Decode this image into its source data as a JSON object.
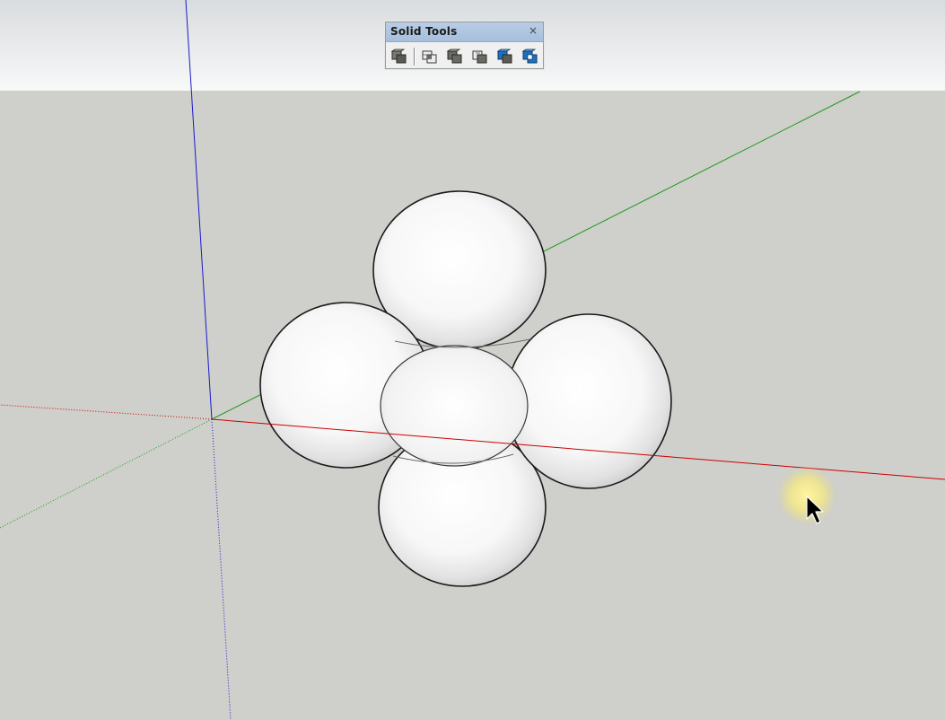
{
  "toolbar": {
    "title": "Solid Tools",
    "close_glyph": "×",
    "tools": [
      {
        "icon": "outer-shell-icon",
        "accent": "#5a5a52"
      },
      {
        "icon": "intersect-icon",
        "accent": "#5a5a52"
      },
      {
        "icon": "union-icon",
        "accent": "#5a5a52"
      },
      {
        "icon": "subtract-icon",
        "accent": "#5a5a52"
      },
      {
        "icon": "trim-icon",
        "accent": "#1f6fbf"
      },
      {
        "icon": "split-icon",
        "accent": "#1f6fbf"
      }
    ]
  },
  "scene": {
    "sky_color": "#eef0f1",
    "ground_color": "#cfcfcb",
    "axis_colors": {
      "red": "#cc0000",
      "green": "#1a9a1a",
      "blue": "#1a1acc"
    }
  }
}
